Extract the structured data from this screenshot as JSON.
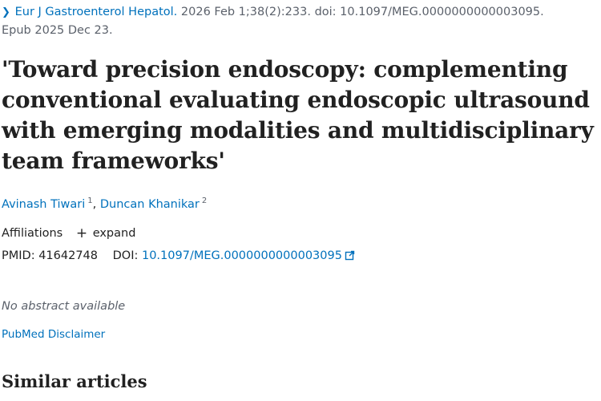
{
  "citation": {
    "journal": "Eur J Gastroenterol Hepatol.",
    "details": " 2026 Feb 1;38(2):233. doi: 10.1097/MEG.0000000000003095.",
    "epub": "Epub 2025 Dec 23."
  },
  "title": "'Toward precision endoscopy: complementing conventional evaluating endoscopic ultrasound with emerging modalities and multidisciplinary team frameworks'",
  "authors": [
    {
      "name": "Avinash Tiwari",
      "sup": "1"
    },
    {
      "name": "Duncan Khanikar",
      "sup": "2"
    }
  ],
  "affiliations": {
    "label": "Affiliations",
    "expand": "expand"
  },
  "identifiers": {
    "pmid_label": "PMID:",
    "pmid": "41642748",
    "doi_label": "DOI:",
    "doi": "10.1097/MEG.0000000000003095"
  },
  "abstract": {
    "note": "No abstract available"
  },
  "disclaimer": "PubMed Disclaimer",
  "similar_heading": "Similar articles",
  "colors": {
    "link": "#0071bc",
    "text": "#212121",
    "muted": "#5b616b"
  }
}
